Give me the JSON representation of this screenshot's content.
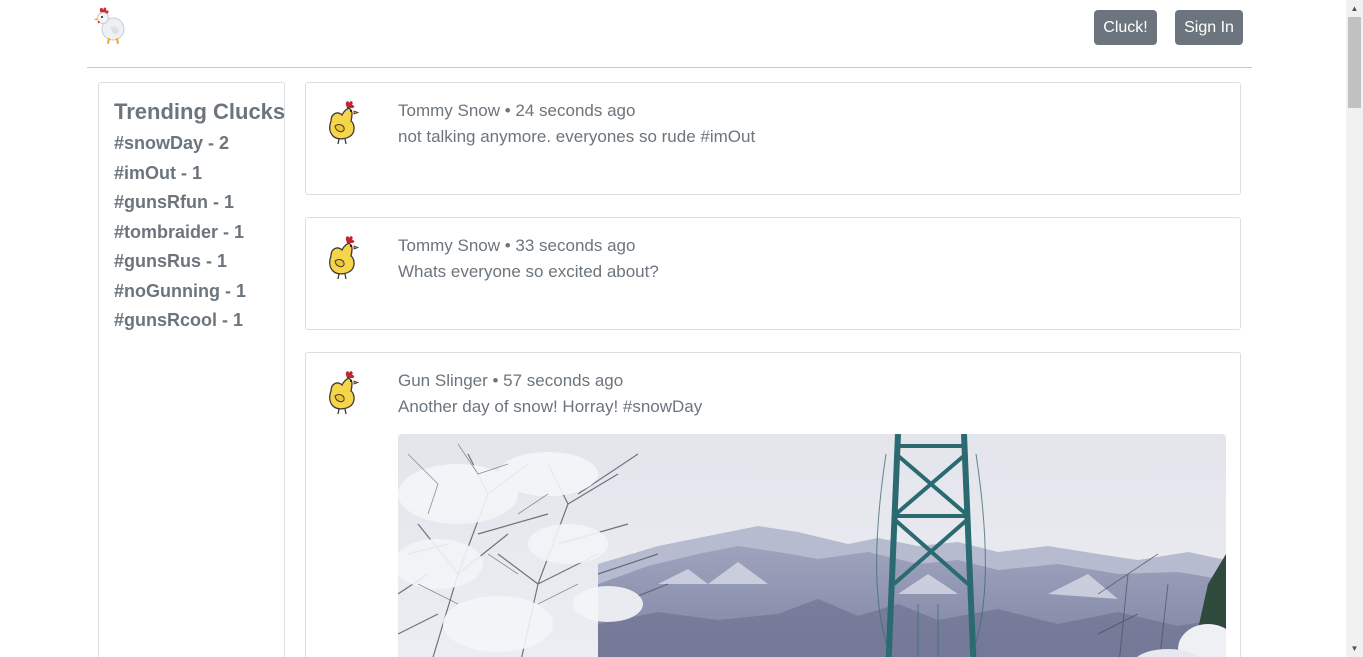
{
  "header": {
    "logo_icon": "chicken-logo-icon",
    "cluck_label": "Cluck!",
    "signin_label": "Sign In",
    "button_color": "#6c757d"
  },
  "sidebar": {
    "title": "Trending Clucks",
    "trends": [
      "#snowDay - 2",
      "#imOut - 1",
      "#gunsRfun - 1",
      "#tombraider - 1",
      "#gunsRus - 1",
      "#noGunning - 1",
      "#gunsRcool - 1"
    ]
  },
  "posts": [
    {
      "meta": "Tommy Snow • 24 seconds ago",
      "text": "not talking anymore. everyones so rude #imOut",
      "avatar_icon": "chicken-avatar-icon"
    },
    {
      "meta": "Tommy Snow • 33 seconds ago",
      "text": "Whats everyone so excited about?",
      "avatar_icon": "chicken-avatar-icon"
    },
    {
      "meta": "Gun Slinger • 57 seconds ago",
      "text": "Another day of snow! Horray! #snowDay",
      "avatar_icon": "chicken-avatar-icon",
      "image": "snowy-suspension-bridge-photo"
    }
  ],
  "colors": {
    "text_muted": "#6c757d",
    "border": "#dcdfe2",
    "bridge_teal": "#2c6a72"
  }
}
